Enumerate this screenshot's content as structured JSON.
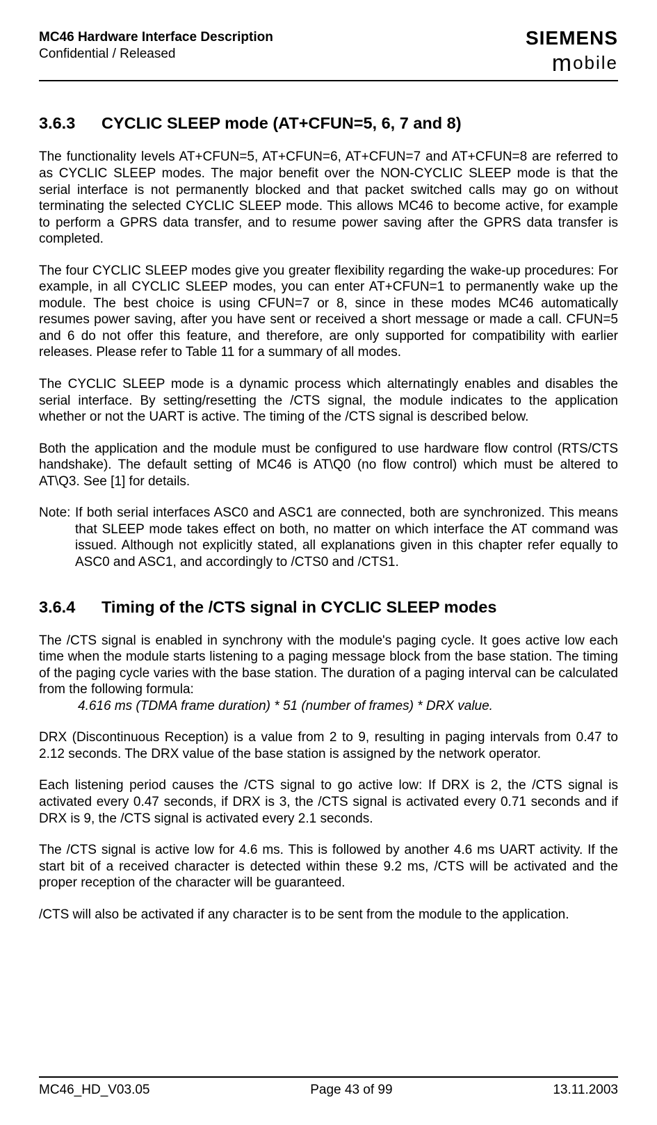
{
  "header": {
    "title": "MC46 Hardware Interface Description",
    "confidentiality": "Confidential / Released",
    "logo_top": "SIEMENS",
    "logo_bottom_m": "m",
    "logo_bottom_rest": "obile"
  },
  "section1": {
    "number": "3.6.3",
    "title": "CYCLIC SLEEP mode (AT+CFUN=5, 6, 7 and 8)",
    "p1": "The functionality levels AT+CFUN=5, AT+CFUN=6, AT+CFUN=7 and AT+CFUN=8 are referred to as CYCLIC SLEEP modes. The major benefit over the NON-CYCLIC SLEEP mode is that the serial interface is not permanently blocked and that packet switched calls may go on without terminating the selected CYCLIC SLEEP mode. This allows MC46 to become active, for example to perform a GPRS data transfer, and to resume power saving after the GPRS data transfer is completed.",
    "p2": "The four CYCLIC SLEEP modes give you greater flexibility regarding the wake-up procedures: For example, in all CYCLIC SLEEP modes, you can enter AT+CFUN=1 to permanently wake up the module. The best choice is using CFUN=7 or 8, since in these modes MC46 automatically resumes power saving, after you have sent or received a short message or made a call. CFUN=5 and 6 do not offer this feature, and therefore, are only supported for compatibility with earlier releases. Please refer to Table 11 for a summary of all modes.",
    "p3": "The CYCLIC SLEEP mode is a dynamic process which alternatingly enables and disables the serial interface. By setting/resetting the /CTS signal, the module indicates to the application whether or not the UART is active. The timing of the /CTS signal is described below.",
    "p4": "Both the application and the module must be configured to use hardware flow control (RTS/CTS handshake). The default setting of MC46 is AT\\Q0 (no flow control) which must be altered to AT\\Q3. See [1] for details.",
    "note_label": "Note:",
    "note_body": "If both serial interfaces ASC0 and ASC1 are connected, both are synchronized. This means that SLEEP mode takes effect on both, no matter on which interface the AT command was issued. Although not explicitly stated, all explanations given in this chapter refer equally to ASC0 and ASC1, and accordingly to /CTS0 and /CTS1."
  },
  "section2": {
    "number": "3.6.4",
    "title": "Timing of the /CTS signal in CYCLIC SLEEP modes",
    "p1": "The /CTS signal is enabled in synchrony with the module's paging cycle. It goes active low each time when the module starts listening to a paging message block from the base station. The timing of the paging cycle varies with the base station. The duration of a paging interval can be calculated from the following formula:",
    "formula": "4.616 ms (TDMA frame duration) * 51 (number of frames) * DRX value.",
    "p2": "DRX (Discontinuous Reception) is a value from 2 to 9, resulting in paging intervals from 0.47 to 2.12 seconds. The DRX value of the base station is assigned by the network operator.",
    "p3": "Each listening period causes the /CTS signal to go active low: If DRX is 2, the /CTS signal is activated every 0.47 seconds, if DRX is 3, the /CTS signal is activated every 0.71 seconds and if DRX is 9, the /CTS signal is activated every 2.1 seconds.",
    "p4": "The /CTS signal is active low for 4.6 ms. This is followed by another 4.6 ms UART activity. If the start bit of a received character is detected within these 9.2 ms, /CTS will be activated and the proper reception of the character will be guaranteed.",
    "p5": "/CTS will also be activated if any character is to be sent from the module to the application."
  },
  "footer": {
    "left": "MC46_HD_V03.05",
    "center": "Page 43 of 99",
    "right": "13.11.2003"
  }
}
